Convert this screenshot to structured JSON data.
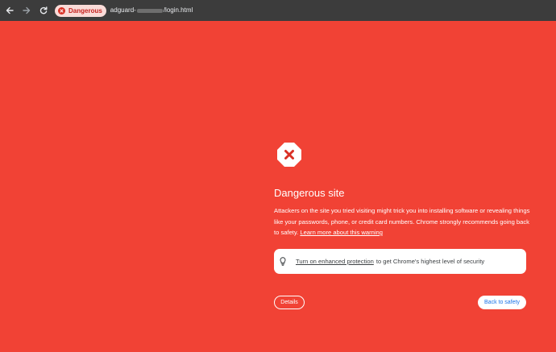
{
  "toolbar": {
    "back_icon": "arrow-left-icon",
    "forward_icon": "arrow-right-icon",
    "reload_icon": "reload-icon",
    "security_chip": {
      "label": "Dangerous",
      "icon": "danger-icon"
    },
    "url": {
      "host_prefix": "adguard-",
      "path": "/login.html"
    }
  },
  "interstitial": {
    "icon": "danger-octagon-icon",
    "title": "Dangerous site",
    "body": "Attackers on the site you tried visiting might trick you into installing software or revealing things like your passwords, phone, or credit card numbers. Chrome strongly recommends going back to safety.",
    "learn_more": "Learn more about this warning",
    "promo": {
      "icon": "lightbulb-icon",
      "link": "Turn on enhanced protection",
      "rest": "to get Chrome's highest level of security"
    },
    "details_button": "Details",
    "back_button": "Back to safety"
  },
  "colors": {
    "background": "#F14235",
    "toolbar": "#3C3C3C",
    "chip_bg": "#FADBD8",
    "chip_text": "#C5221F",
    "button_blue": "#1A73E8"
  }
}
